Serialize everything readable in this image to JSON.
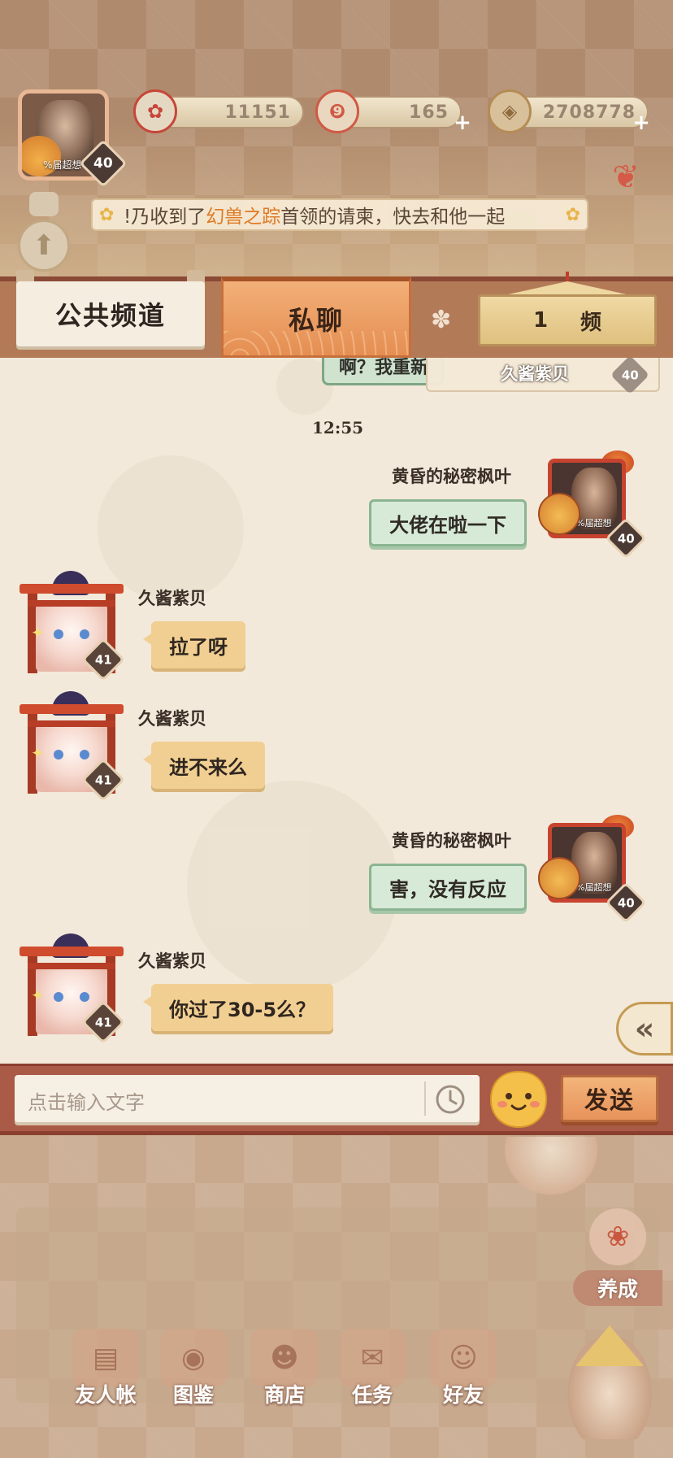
{
  "hud": {
    "player_avatar_tag": "%届超想",
    "player_level": "40",
    "stat_blossom": "11151",
    "stat_scroll": "165",
    "stat_coins": "2708778",
    "stat_blossom_icon": "plum-blossom-icon",
    "stat_scroll_icon": "scroll-icon",
    "stat_coins_icon": "coin-icon"
  },
  "notice": {
    "prefix": "!乃收到了",
    "highlight": "幻兽之踪",
    "suffix": "首领的请柬，快去和他一起"
  },
  "tabs": {
    "public": "公共频道",
    "private": "私聊",
    "sign_left": "1",
    "sign_right": "频"
  },
  "chat": {
    "partial_bubble": "啊？我重新",
    "partial_card_name": "久酱紫贝",
    "partial_card_level": "40",
    "timestamp": "12:55",
    "self_name": "黄昏的秘密枫叶",
    "friend_name": "久酱紫贝",
    "self_level": "40",
    "friend_level": "41",
    "self_avatar_tag": "%届超想",
    "messages": [
      {
        "from": "self",
        "text": "大佬在啦一下"
      },
      {
        "from": "friend",
        "text": "拉了呀"
      },
      {
        "from": "friend",
        "text": "进不来么"
      },
      {
        "from": "self",
        "text": "害，没有反应"
      },
      {
        "from": "friend",
        "text": "你过了30-5么？"
      }
    ]
  },
  "input": {
    "placeholder": "点击输入文字",
    "send_label": "发送"
  },
  "nav": {
    "items": [
      {
        "label": "友人帐",
        "icon": "book-icon"
      },
      {
        "label": "图鉴",
        "icon": "eye-scroll-icon"
      },
      {
        "label": "商店",
        "icon": "lucky-cat-icon"
      },
      {
        "label": "任务",
        "icon": "task-icon"
      },
      {
        "label": "好友",
        "icon": "friends-icon"
      }
    ],
    "nurture_label": "养成"
  },
  "colors": {
    "tab_active": "#e58e52",
    "bubble_self": "#d7ead8",
    "bubble_friend": "#f1cf93",
    "highlight": "#e07a24",
    "input_bar": "#a95b47"
  }
}
